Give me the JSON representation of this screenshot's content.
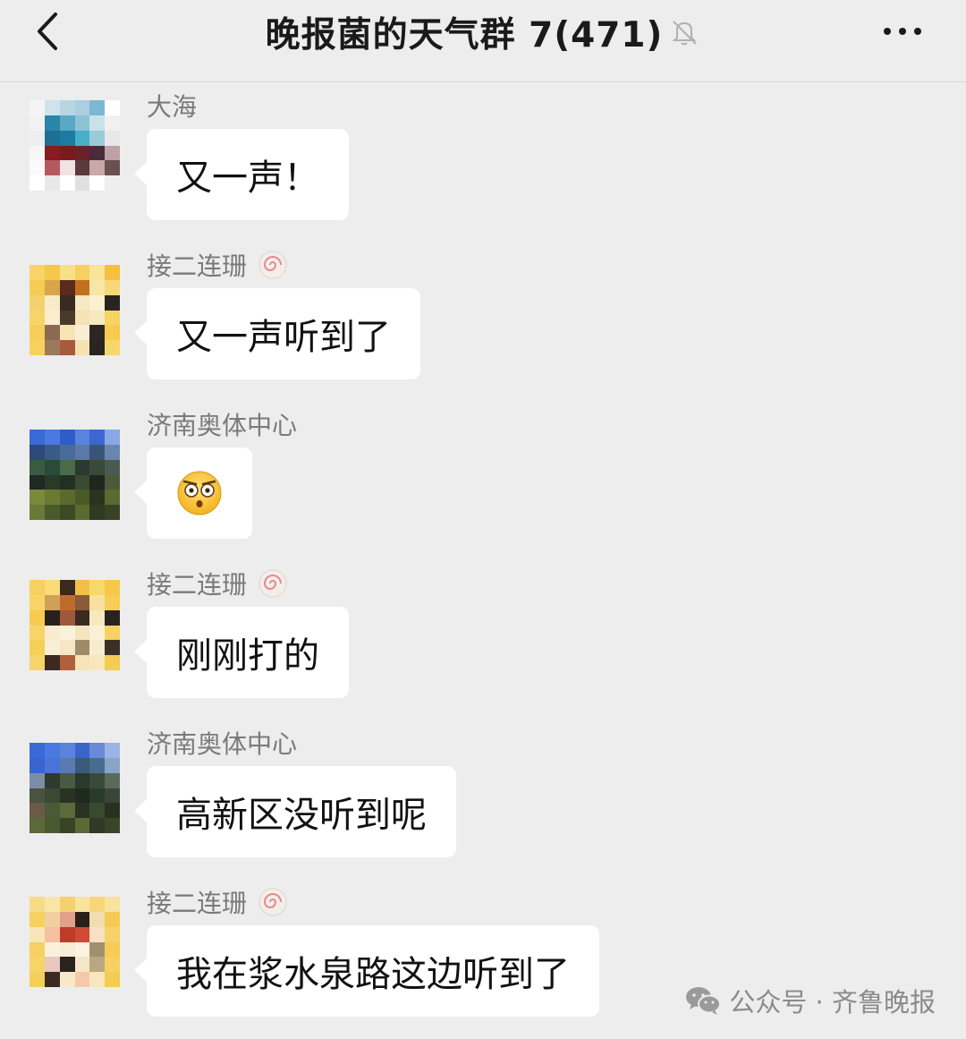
{
  "header": {
    "title": "晚报菌的天气群 7(471)",
    "back_icon": "chevron-left-icon",
    "mute_icon": "bell-muted-icon",
    "more_icon": "more-dots-icon"
  },
  "messages": [
    {
      "sender": "大海",
      "text": "又一声！",
      "has_badge": false
    },
    {
      "sender": "接二连珊",
      "text": "又一声听到了",
      "has_badge": true
    },
    {
      "sender": "济南奥体中心",
      "text": "",
      "emoji": "shocked-face-emoji",
      "has_badge": false
    },
    {
      "sender": "接二连珊",
      "text": "刚刚打的",
      "has_badge": true
    },
    {
      "sender": "济南奥体中心",
      "text": "高新区没听到呢",
      "has_badge": false
    },
    {
      "sender": "接二连珊",
      "text": "我在浆水泉路这边听到了",
      "has_badge": true
    }
  ],
  "watermark": {
    "text": "公众号 · 齐鲁晚报",
    "icon": "wechat-icon"
  },
  "colors": {
    "background": "#ededed",
    "bubble": "#ffffff",
    "sender_text": "#7a7a7a"
  }
}
